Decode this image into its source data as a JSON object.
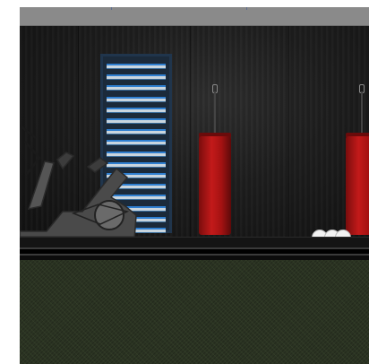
{
  "scene": {
    "objects": [
      {
        "name": "wall-bars"
      },
      {
        "name": "punching-bag-left",
        "color": "#b01515"
      },
      {
        "name": "punching-bag-right",
        "color": "#b01515"
      },
      {
        "name": "exercise-bike"
      },
      {
        "name": "dumbbell-weights",
        "color": "#f2f2f2"
      }
    ],
    "colors": {
      "wall": "#1d1d1d",
      "grass": "#2b3323",
      "top_bar": "#8a8a8a",
      "wall_bars_accent": "#2f7fd0"
    }
  }
}
